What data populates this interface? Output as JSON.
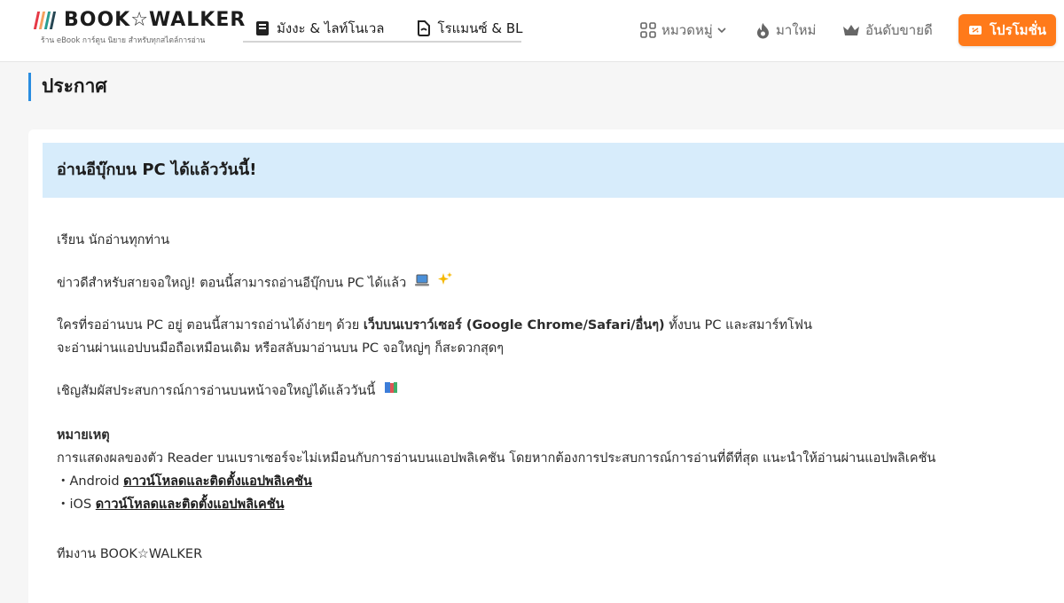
{
  "brand": {
    "name": "BOOK☆WALKER",
    "tagline": "ร้าน eBook การ์ตูน นิยาย สำหรับทุกสไตล์การอ่าน",
    "bar_colors": [
      "#e63946",
      "#f4a261",
      "#2a9d8f",
      "#264653"
    ]
  },
  "tabs": [
    {
      "label": "มังงะ & ไลท์โนเวล",
      "icon": "book-icon"
    },
    {
      "label": "โรแมนซ์ & BL",
      "icon": "romance-bookmark-icon"
    }
  ],
  "nav": {
    "categories": {
      "label": "หมวดหมู่",
      "icon": "grid-icon"
    },
    "new": {
      "label": "มาใหม่",
      "icon": "flame-icon"
    },
    "ranking": {
      "label": "อันดับขายดี",
      "icon": "crown-icon"
    },
    "promo": {
      "label": "โปรโมชั่น",
      "icon": "ticket-icon"
    }
  },
  "page": {
    "title": "ประกาศ"
  },
  "announcement": {
    "title": "อ่านอีบุ๊กบน PC ได้แล้ววันนี้!",
    "greeting": "เรียน นักอ่านทุกท่าน",
    "p1": "ข่าวดีสำหรับสายจอใหญ่! ตอนนี้สามารถอ่านอีบุ๊กบน PC ได้แล้ว",
    "p2_a": "ใครที่รออ่านบน PC อยู่ ตอนนี้สามารถอ่านได้ง่ายๆ ด้วย ",
    "p2_bold": "เว็บบนเบราว์เซอร์ (Google Chrome/Safari/อื่นๆ)",
    "p2_b": " ทั้งบน PC และสมาร์ทโฟน",
    "p2_line2": "จะอ่านผ่านแอปบนมือถือเหมือนเดิม หรือสลับมาอ่านบน PC จอใหญ่ๆ ก็สะดวกสุดๆ",
    "p3": "เชิญสัมผัสประสบการณ์การอ่านบนหน้าจอใหญ่ได้แล้ววันนี้",
    "note_title": "หมายเหตุ",
    "note_text": "การแสดงผลของตัว Reader บนเบราเซอร์จะไม่เหมือนกับการอ่านบนแอปพลิเคชัน โดยหากต้องการประสบการณ์การอ่านที่ดีที่สุด แนะนำให้อ่านผ่านแอปพลิเคชัน",
    "android_prefix": "・Android ",
    "android_link": "ดาวน์โหลดและติดตั้งแอปพลิเคชัน",
    "ios_prefix": "・iOS ",
    "ios_link": "ดาวน์โหลดและติดตั้งแอปพลิเคชัน",
    "signature": "ทีมงาน BOOK☆WALKER"
  }
}
